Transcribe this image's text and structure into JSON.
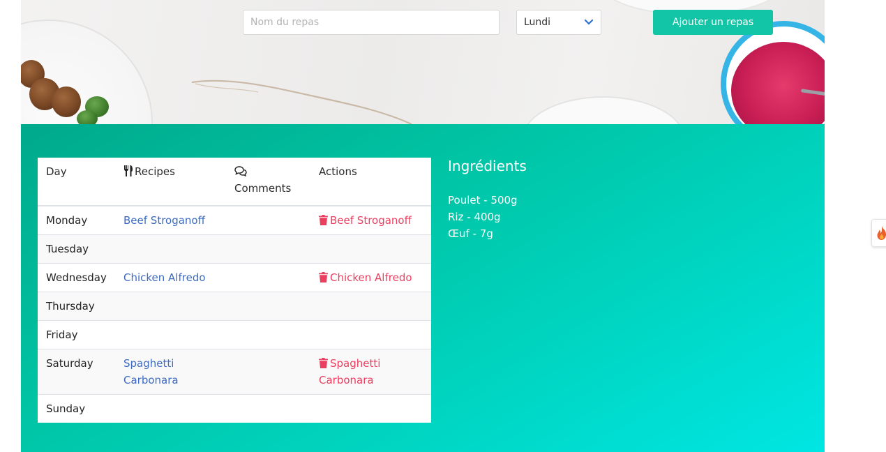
{
  "form": {
    "meal_placeholder": "Nom du repas",
    "day_selected": "Lundi",
    "add_button_label": "Ajouter un repas"
  },
  "table": {
    "headers": {
      "day": "Day",
      "recipes": "Recipes",
      "comments_line1": "",
      "comments": "Comments",
      "actions": "Actions"
    },
    "rows": [
      {
        "day": "Monday",
        "recipe": "Beef Stroganoff",
        "comment": "",
        "action": "Beef Stroganoff"
      },
      {
        "day": "Tuesday",
        "recipe": "",
        "comment": "",
        "action": ""
      },
      {
        "day": "Wednesday",
        "recipe": "Chicken Alfredo",
        "comment": "",
        "action": "Chicken Alfredo"
      },
      {
        "day": "Thursday",
        "recipe": "",
        "comment": "",
        "action": ""
      },
      {
        "day": "Friday",
        "recipe": "",
        "comment": "",
        "action": ""
      },
      {
        "day": "Saturday",
        "recipe": "Spaghetti Carbonara",
        "comment": "",
        "action": "Spaghetti Carbonara"
      },
      {
        "day": "Sunday",
        "recipe": "",
        "comment": "",
        "action": ""
      }
    ]
  },
  "ingredients": {
    "title": "Ingrédients",
    "items": [
      "Poulet - 500g",
      "Riz - 400g",
      "Œuf - 7g"
    ]
  },
  "icons": {
    "recipes_header": "utensils-icon",
    "comments_header": "comments-icon",
    "delete": "trash-icon",
    "select": "chevron-down-icon",
    "side_widget": "flame-icon"
  },
  "colors": {
    "accent_button": "#11c5a6",
    "link": "#3d6bc1",
    "delete": "#ea3f5f",
    "section_start": "#00a98b",
    "section_end": "#00e6e3"
  }
}
